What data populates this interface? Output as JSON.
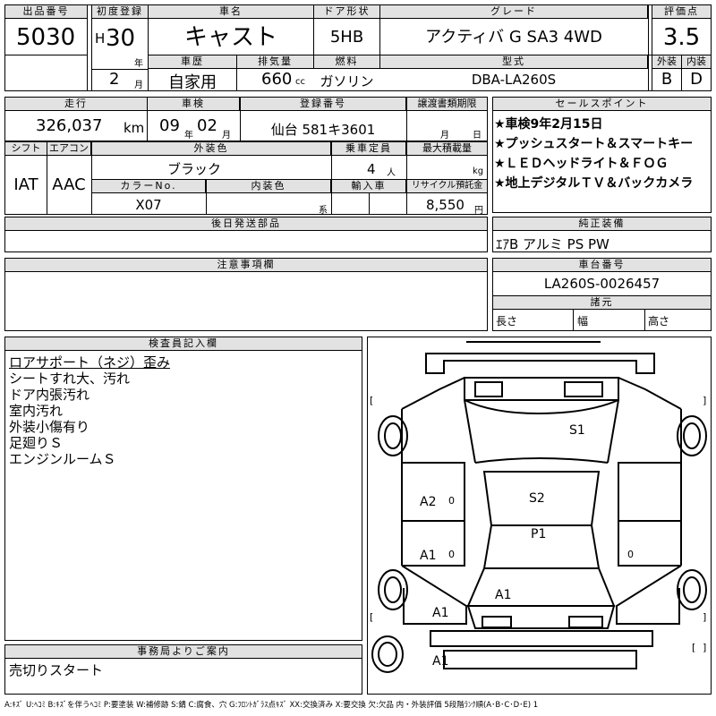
{
  "header": {
    "lot_no": {
      "label": "出品番号",
      "value": "5030"
    },
    "first_reg": {
      "label": "初度登録",
      "era": "H",
      "year": "30",
      "year_unit": "年",
      "month": "2",
      "month_unit": "月"
    },
    "car_name": {
      "label": "車名",
      "value": "キャスト"
    },
    "door_type": {
      "label": "ドア形状",
      "value": "5HB"
    },
    "grade": {
      "label": "グレード",
      "value": "アクティバ G SA3 4WD"
    },
    "score": {
      "label": "評価点",
      "value": "3.5"
    },
    "history": {
      "label": "車歴",
      "value": "自家用"
    },
    "displacement": {
      "label": "排気量",
      "value": "660",
      "unit": "cc"
    },
    "fuel": {
      "label": "燃料",
      "value": "ガソリン"
    },
    "model": {
      "label": "型式",
      "value": "DBA-LA260S"
    },
    "exterior_grade": {
      "label": "外装",
      "value": "B"
    },
    "interior_grade": {
      "label": "内装",
      "value": "D"
    }
  },
  "row2": {
    "mileage": {
      "label": "走行",
      "value": "326,037",
      "unit": "km"
    },
    "inspection": {
      "label": "車検",
      "year": "09",
      "year_unit": "年",
      "month": "02",
      "month_unit": "月"
    },
    "plate": {
      "label": "登録番号",
      "value": "仙台 581キ3601"
    },
    "transfer_deadline": {
      "label": "譲渡書類期限",
      "month_unit": "月",
      "day_unit": "日"
    },
    "sales_points": {
      "label": "セールスポイント",
      "items": [
        "★車検9年2月15日",
        "★プッシュスタート＆スマートキー",
        "★ＬＥＤヘッドライト＆ＦＯＧ",
        "★地上デジタルＴＶ＆バックカメラ"
      ]
    }
  },
  "row3": {
    "shift": {
      "label": "シフト",
      "value": "IAT"
    },
    "aircon": {
      "label": "エアコン",
      "value": "AAC"
    },
    "ext_color": {
      "label": "外装色",
      "value": "ブラック"
    },
    "capacity": {
      "label": "乗車定員",
      "value": "4",
      "unit": "人"
    },
    "max_load": {
      "label": "最大積載量",
      "unit": "kg"
    },
    "color_no": {
      "label": "カラーNo.",
      "value": "X07"
    },
    "int_color": {
      "label": "内装色",
      "unit": "系"
    },
    "import": {
      "label": "輸入車"
    },
    "recycle": {
      "label": "リサイクル預託金",
      "value": "8,550",
      "unit": "円"
    }
  },
  "later_parts": {
    "label": "後日発送部品"
  },
  "genuine_equipment": {
    "label": "純正装備",
    "value": "ｴｱB アルミ PS PW"
  },
  "notes": {
    "label": "注意事項欄"
  },
  "chassis": {
    "label": "車台番号",
    "value": "LA260S-0026457",
    "specs_label": "諸元",
    "length": "長さ",
    "width": "幅",
    "height": "高さ"
  },
  "inspector": {
    "label": "検査員記入欄",
    "lines": [
      "ロアサポート（ネジ）歪み",
      "シートすれ大、汚れ",
      "ドア内張汚れ",
      "室内汚れ",
      "外装小傷有り",
      "足廻りＳ",
      "エンジンルームＳ"
    ]
  },
  "office": {
    "label": "事務局よりご案内",
    "value": "売切りスタート"
  },
  "diagram_marks": {
    "roof_s1": "S1",
    "rear_door_left": "A2",
    "rear_door_left_zero": "0",
    "center_s2": "S2",
    "center_p1": "P1",
    "front_door_left": "A1",
    "front_door_left_zero": "0",
    "right_zero": "0",
    "hood": "A1",
    "front_fender_left": "A1",
    "front_bumper": "A1",
    "bracket_l1": "[",
    "bracket_r1": "]",
    "bracket_l2": "[",
    "bracket_r2": "]",
    "bracket_l3": "[",
    "bracket_r3": "]"
  },
  "legend": "A:ｷｽﾞ U:ﾍｺﾐ B:ｷｽﾞを伴うﾍｺﾐ P:要塗装 W:補修跡 S:錆 C:腐食、穴 G:ﾌﾛﾝﾄｶﾞﾗｽ点ｷｽﾞ XX:交換済み X:要交換 欠:欠品 内・外装評価 5段階ﾗﾝｸ順(A･B･C･D･E) 1"
}
